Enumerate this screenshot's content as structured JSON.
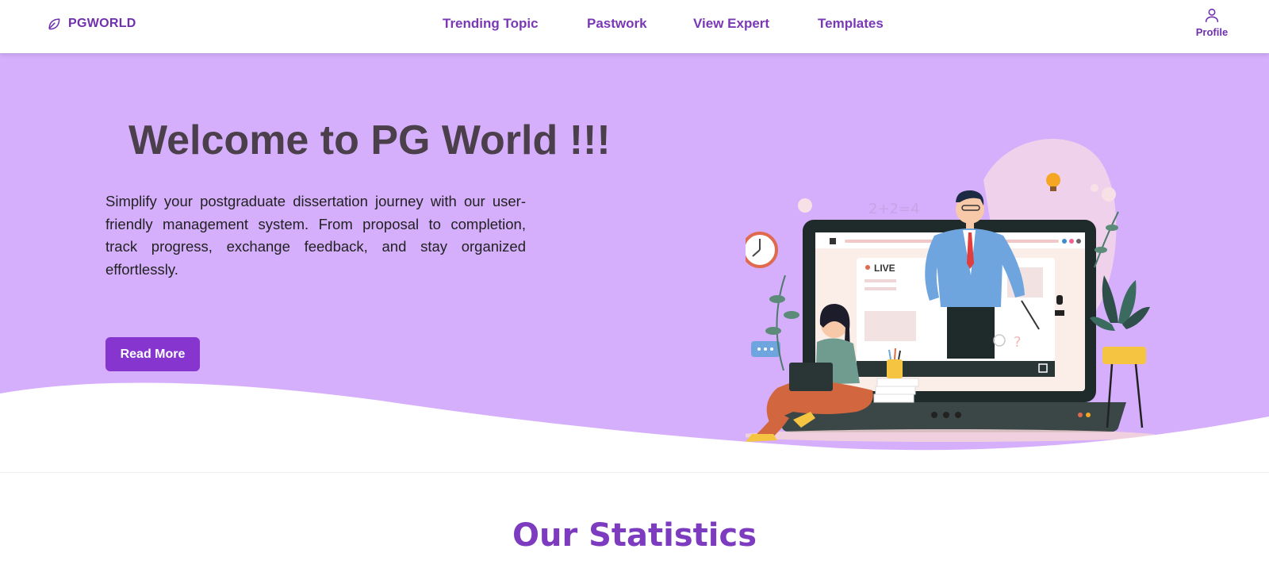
{
  "header": {
    "brand": "PGWORLD",
    "nav": [
      {
        "label": "Trending Topic"
      },
      {
        "label": "Pastwork"
      },
      {
        "label": "View Expert"
      },
      {
        "label": "Templates"
      }
    ],
    "profile_label": "Profile"
  },
  "hero": {
    "title": "Welcome to PG World !!!",
    "description": "Simplify your postgraduate dissertation journey with our user-friendly management system. From proposal to completion, track progress, exchange feedback, and stay organized effortlessly.",
    "button_label": "Read More",
    "illustration": {
      "live_badge": "LIVE",
      "board_text": "2+2=4"
    }
  },
  "stats": {
    "title": "Our Statistics"
  },
  "colors": {
    "brand": "#6f2fae",
    "hero_bg": "#d5affc",
    "button": "#8636cf",
    "stats_title": "#7d3bbf"
  }
}
